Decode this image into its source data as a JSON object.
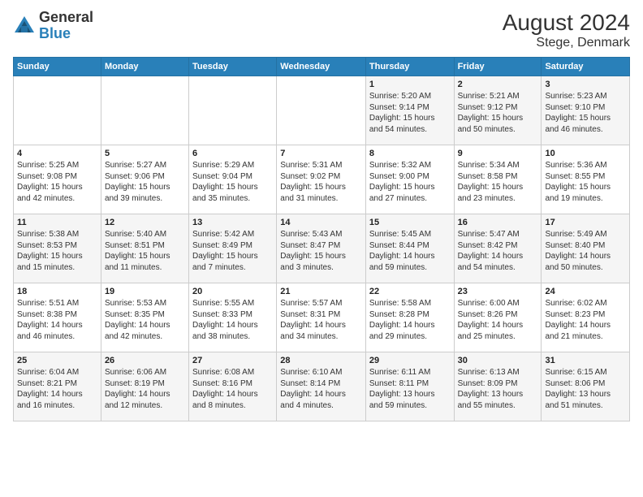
{
  "header": {
    "logo_general": "General",
    "logo_blue": "Blue",
    "month_year": "August 2024",
    "location": "Stege, Denmark"
  },
  "weekdays": [
    "Sunday",
    "Monday",
    "Tuesday",
    "Wednesday",
    "Thursday",
    "Friday",
    "Saturday"
  ],
  "weeks": [
    [
      {
        "day": "",
        "info": ""
      },
      {
        "day": "",
        "info": ""
      },
      {
        "day": "",
        "info": ""
      },
      {
        "day": "",
        "info": ""
      },
      {
        "day": "1",
        "info": "Sunrise: 5:20 AM\nSunset: 9:14 PM\nDaylight: 15 hours\nand 54 minutes."
      },
      {
        "day": "2",
        "info": "Sunrise: 5:21 AM\nSunset: 9:12 PM\nDaylight: 15 hours\nand 50 minutes."
      },
      {
        "day": "3",
        "info": "Sunrise: 5:23 AM\nSunset: 9:10 PM\nDaylight: 15 hours\nand 46 minutes."
      }
    ],
    [
      {
        "day": "4",
        "info": "Sunrise: 5:25 AM\nSunset: 9:08 PM\nDaylight: 15 hours\nand 42 minutes."
      },
      {
        "day": "5",
        "info": "Sunrise: 5:27 AM\nSunset: 9:06 PM\nDaylight: 15 hours\nand 39 minutes."
      },
      {
        "day": "6",
        "info": "Sunrise: 5:29 AM\nSunset: 9:04 PM\nDaylight: 15 hours\nand 35 minutes."
      },
      {
        "day": "7",
        "info": "Sunrise: 5:31 AM\nSunset: 9:02 PM\nDaylight: 15 hours\nand 31 minutes."
      },
      {
        "day": "8",
        "info": "Sunrise: 5:32 AM\nSunset: 9:00 PM\nDaylight: 15 hours\nand 27 minutes."
      },
      {
        "day": "9",
        "info": "Sunrise: 5:34 AM\nSunset: 8:58 PM\nDaylight: 15 hours\nand 23 minutes."
      },
      {
        "day": "10",
        "info": "Sunrise: 5:36 AM\nSunset: 8:55 PM\nDaylight: 15 hours\nand 19 minutes."
      }
    ],
    [
      {
        "day": "11",
        "info": "Sunrise: 5:38 AM\nSunset: 8:53 PM\nDaylight: 15 hours\nand 15 minutes."
      },
      {
        "day": "12",
        "info": "Sunrise: 5:40 AM\nSunset: 8:51 PM\nDaylight: 15 hours\nand 11 minutes."
      },
      {
        "day": "13",
        "info": "Sunrise: 5:42 AM\nSunset: 8:49 PM\nDaylight: 15 hours\nand 7 minutes."
      },
      {
        "day": "14",
        "info": "Sunrise: 5:43 AM\nSunset: 8:47 PM\nDaylight: 15 hours\nand 3 minutes."
      },
      {
        "day": "15",
        "info": "Sunrise: 5:45 AM\nSunset: 8:44 PM\nDaylight: 14 hours\nand 59 minutes."
      },
      {
        "day": "16",
        "info": "Sunrise: 5:47 AM\nSunset: 8:42 PM\nDaylight: 14 hours\nand 54 minutes."
      },
      {
        "day": "17",
        "info": "Sunrise: 5:49 AM\nSunset: 8:40 PM\nDaylight: 14 hours\nand 50 minutes."
      }
    ],
    [
      {
        "day": "18",
        "info": "Sunrise: 5:51 AM\nSunset: 8:38 PM\nDaylight: 14 hours\nand 46 minutes."
      },
      {
        "day": "19",
        "info": "Sunrise: 5:53 AM\nSunset: 8:35 PM\nDaylight: 14 hours\nand 42 minutes."
      },
      {
        "day": "20",
        "info": "Sunrise: 5:55 AM\nSunset: 8:33 PM\nDaylight: 14 hours\nand 38 minutes."
      },
      {
        "day": "21",
        "info": "Sunrise: 5:57 AM\nSunset: 8:31 PM\nDaylight: 14 hours\nand 34 minutes."
      },
      {
        "day": "22",
        "info": "Sunrise: 5:58 AM\nSunset: 8:28 PM\nDaylight: 14 hours\nand 29 minutes."
      },
      {
        "day": "23",
        "info": "Sunrise: 6:00 AM\nSunset: 8:26 PM\nDaylight: 14 hours\nand 25 minutes."
      },
      {
        "day": "24",
        "info": "Sunrise: 6:02 AM\nSunset: 8:23 PM\nDaylight: 14 hours\nand 21 minutes."
      }
    ],
    [
      {
        "day": "25",
        "info": "Sunrise: 6:04 AM\nSunset: 8:21 PM\nDaylight: 14 hours\nand 16 minutes."
      },
      {
        "day": "26",
        "info": "Sunrise: 6:06 AM\nSunset: 8:19 PM\nDaylight: 14 hours\nand 12 minutes."
      },
      {
        "day": "27",
        "info": "Sunrise: 6:08 AM\nSunset: 8:16 PM\nDaylight: 14 hours\nand 8 minutes."
      },
      {
        "day": "28",
        "info": "Sunrise: 6:10 AM\nSunset: 8:14 PM\nDaylight: 14 hours\nand 4 minutes."
      },
      {
        "day": "29",
        "info": "Sunrise: 6:11 AM\nSunset: 8:11 PM\nDaylight: 13 hours\nand 59 minutes."
      },
      {
        "day": "30",
        "info": "Sunrise: 6:13 AM\nSunset: 8:09 PM\nDaylight: 13 hours\nand 55 minutes."
      },
      {
        "day": "31",
        "info": "Sunrise: 6:15 AM\nSunset: 8:06 PM\nDaylight: 13 hours\nand 51 minutes."
      }
    ]
  ]
}
